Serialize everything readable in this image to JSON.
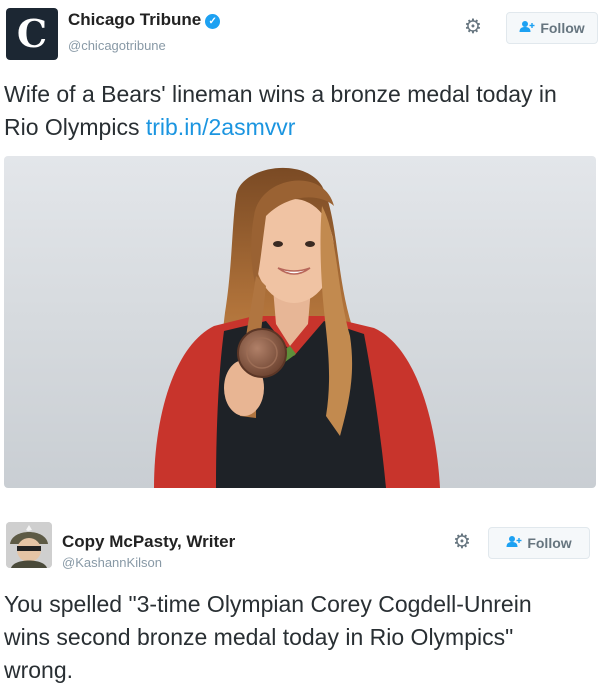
{
  "tweet1": {
    "avatar_letter": "C",
    "display_name": "Chicago Tribune",
    "verified_glyph": "✓",
    "handle": "@chicagotribune",
    "follow_label": "Follow",
    "text_before_link": "Wife of a Bears' lineman wins a bronze medal today in Rio Olympics ",
    "link_text": "trib.in/2asmvvr",
    "icons": {
      "settings": "gear-icon",
      "follow": "add-user-icon",
      "verified": "verified-badge-icon"
    }
  },
  "tweet2": {
    "display_name": "Copy McPasty, Writer",
    "handle": "@KashannKilson",
    "follow_label": "Follow",
    "text": "You spelled \"3-time Olympian Corey Cogdell-Unrein wins second bronze medal today in Rio Olympics\" wrong.",
    "icons": {
      "settings": "gear-icon",
      "follow": "add-user-icon"
    }
  },
  "colors": {
    "link": "#1b95e0",
    "verified": "#1da1f2",
    "follow_icon": "#1da1f2",
    "jacket_red": "#c8342c",
    "jacket_black": "#1e2227",
    "hair": "#b2743b",
    "medal": "#8a5a42"
  }
}
